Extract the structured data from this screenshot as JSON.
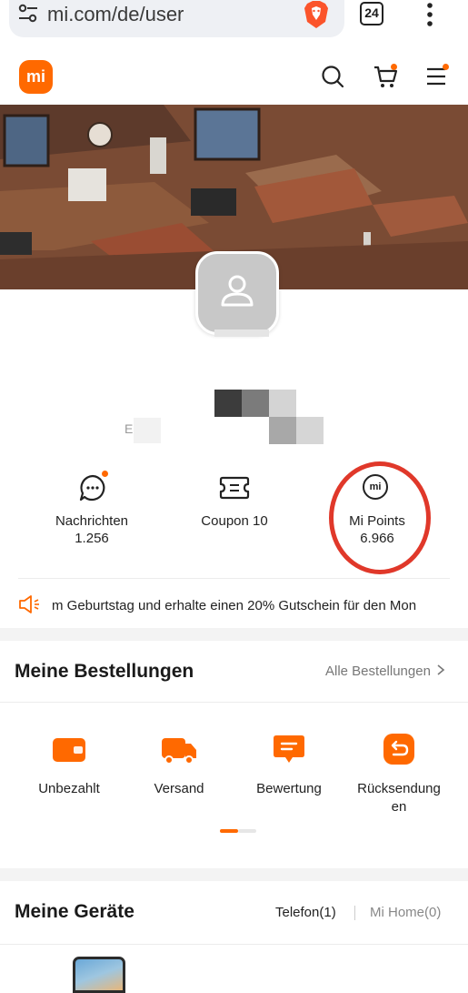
{
  "browser": {
    "url": "mi.com/de/user",
    "tab_count": "24"
  },
  "header": {
    "logo_text": "mi",
    "cart_has_badge": true,
    "menu_has_badge": true
  },
  "profile": {
    "name_partial": "E"
  },
  "stats": {
    "messages": {
      "label": "Nachrichten",
      "value": "1.256",
      "has_badge": true
    },
    "coupon": {
      "label": "Coupon 10"
    },
    "points": {
      "label": "Mi Points",
      "value": "6.966",
      "logo_text": "mi"
    }
  },
  "notice": {
    "text": "m Geburtstag und erhalte einen 20% Gutschein für den Mon"
  },
  "orders": {
    "title": "Meine Bestellungen",
    "all_link": "Alle Bestellungen",
    "items": [
      {
        "label": "Unbezahlt"
      },
      {
        "label": "Versand"
      },
      {
        "label": "Bewertung"
      },
      {
        "label_line1": "Rücksendung",
        "label_line2": "en"
      }
    ]
  },
  "devices": {
    "title": "Meine Geräte",
    "tabs": [
      {
        "label": "Telefon(1)"
      },
      {
        "label": "Mi Home(0)"
      }
    ]
  },
  "colors": {
    "accent": "#ff6900",
    "highlight": "#e0382a"
  }
}
